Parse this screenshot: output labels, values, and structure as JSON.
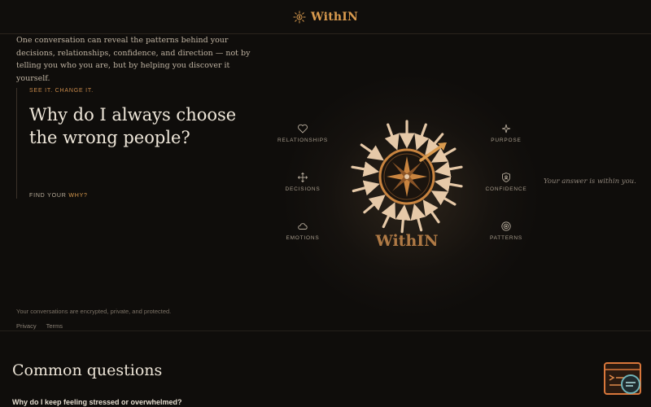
{
  "header": {
    "brand_name": "WithIN",
    "logo_icon": "sunburst-compass-icon"
  },
  "intro": {
    "text": "One conversation can reveal the patterns behind your decisions, relationships, confidence, and direction — not by telling you who you are, but by helping you discover it yourself."
  },
  "hero": {
    "eyebrow": "SEE IT. CHANGE IT.",
    "headline": "Why do I always choose the wrong people?",
    "cta_prefix": "FIND YOUR",
    "cta_accent": "WHY?"
  },
  "features": [
    {
      "label": "RELATIONSHIPS",
      "icon": "heart-icon"
    },
    {
      "label": "PURPOSE",
      "icon": "sparkle-icon"
    },
    {
      "label": "DECISIONS",
      "icon": "move-arrows-icon"
    },
    {
      "label": "CONFIDENCE",
      "icon": "shield-icon"
    },
    {
      "label": "EMOTIONS",
      "icon": "cloud-icon"
    },
    {
      "label": "PATTERNS",
      "icon": "target-icon"
    }
  ],
  "compass": {
    "wordmark": "WithIN"
  },
  "tagline": "Your answer is within you.",
  "footer": {
    "security_note": "Your conversations are encrypted, private, and protected.",
    "links": [
      "Privacy",
      "Terms"
    ]
  },
  "faq": {
    "title": "Common questions",
    "first_question": "Why do I keep feeling stressed or overwhelmed?"
  },
  "chat_widget": {
    "icon": "chat-console-icon"
  },
  "colors": {
    "background": "#0f0d0b",
    "accent": "#d99a4e",
    "text": "#efe7da",
    "muted": "#a79c8c"
  }
}
